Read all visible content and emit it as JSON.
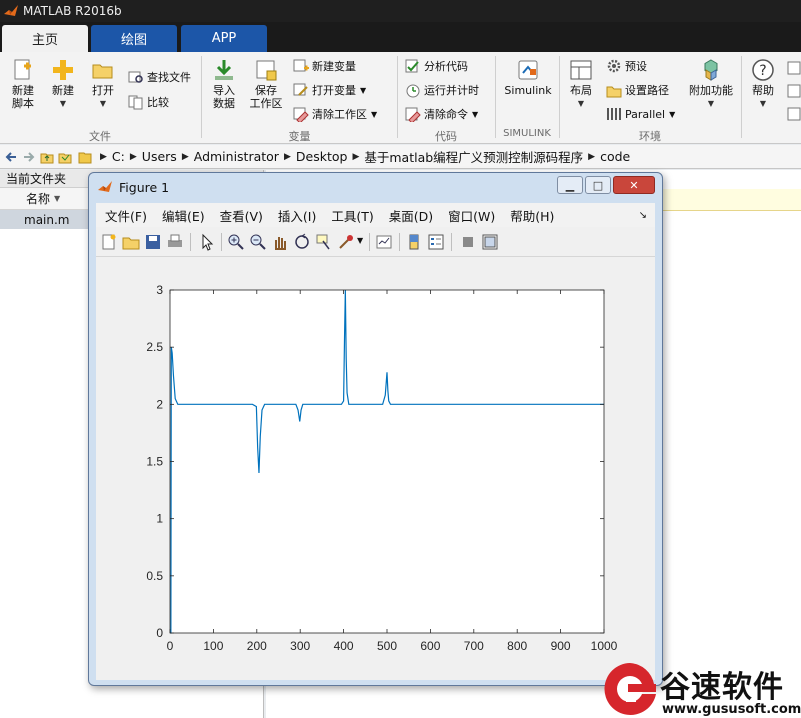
{
  "app": {
    "title": "MATLAB R2016b"
  },
  "tabs": [
    {
      "label": "主页"
    },
    {
      "label": "绘图"
    },
    {
      "label": "APP"
    }
  ],
  "ribbon": {
    "file": {
      "new_script": "新建\n脚本",
      "new": "新建",
      "open": "打开",
      "find_files": "查找文件",
      "compare": "比较",
      "group": "文件"
    },
    "variable": {
      "import": "导入\n数据",
      "save_ws": "保存\n工作区",
      "new_var": "新建变量",
      "open_var": "打开变量",
      "clear_ws": "清除工作区",
      "group": "变量"
    },
    "code": {
      "analyze": "分析代码",
      "run_time": "运行并计时",
      "clear_cmd": "清除命令",
      "group": "代码"
    },
    "simulink": {
      "label": "Simulink",
      "group": "SIMULINK"
    },
    "env": {
      "layout": "布局",
      "prefs": "预设",
      "set_path": "设置路径",
      "parallel": "Parallel",
      "group": "环境"
    },
    "addons": {
      "label": "附加功能"
    },
    "help": {
      "label": "帮助"
    }
  },
  "pathbar": {
    "crumbs": [
      "C:",
      "Users",
      "Administrator",
      "Desktop",
      "基于matlab编程广义预测控制源码程序",
      "code"
    ]
  },
  "current_folder": {
    "title": "当前文件夹",
    "col_name": "名称",
    "files": [
      {
        "name": "main.m"
      }
    ]
  },
  "figure": {
    "title": "Figure 1",
    "menu": [
      "文件(F)",
      "编辑(E)",
      "查看(V)",
      "插入(I)",
      "工具(T)",
      "桌面(D)",
      "窗口(W)",
      "帮助(H)"
    ]
  },
  "chart_data": {
    "type": "line",
    "title": "",
    "xlabel": "",
    "ylabel": "",
    "xlim": [
      0,
      1000
    ],
    "ylim": [
      0,
      3
    ],
    "xticks": [
      0,
      100,
      200,
      300,
      400,
      500,
      600,
      700,
      800,
      900,
      1000
    ],
    "yticks": [
      0,
      0.5,
      1,
      1.5,
      2,
      2.5,
      3
    ],
    "grid": false,
    "line_color": "#0072bd",
    "series": [
      {
        "x": [
          1,
          2,
          3,
          5,
          8,
          12,
          18,
          30,
          60,
          100,
          150,
          190,
          199,
          202,
          205,
          208,
          212,
          218,
          230,
          260,
          290,
          295,
          299,
          302,
          306,
          320,
          360,
          395,
          400,
          402,
          404,
          406,
          408,
          412,
          420,
          450,
          490,
          496,
          500,
          502,
          504,
          508,
          514,
          550,
          600,
          650,
          700,
          750,
          800,
          850,
          900,
          950,
          1000
        ],
        "y": [
          0,
          0,
          2.5,
          2.45,
          2.25,
          2.05,
          2.0,
          2.0,
          2.0,
          2.0,
          2.0,
          2.0,
          1.98,
          1.62,
          1.4,
          1.72,
          1.95,
          2.0,
          2.0,
          2.0,
          2.0,
          1.95,
          1.85,
          1.95,
          2.0,
          2.0,
          2.0,
          2.0,
          2.03,
          2.55,
          3.0,
          2.4,
          2.1,
          2.0,
          2.0,
          2.0,
          2.0,
          2.08,
          2.28,
          2.12,
          2.03,
          2.0,
          2.0,
          2.0,
          2.0,
          2.0,
          2.0,
          2.0,
          2.0,
          2.0,
          2.0,
          2.0,
          2.0
        ]
      }
    ]
  },
  "watermark": {
    "brand": "谷速软件",
    "url": "www.gususoft.com"
  }
}
